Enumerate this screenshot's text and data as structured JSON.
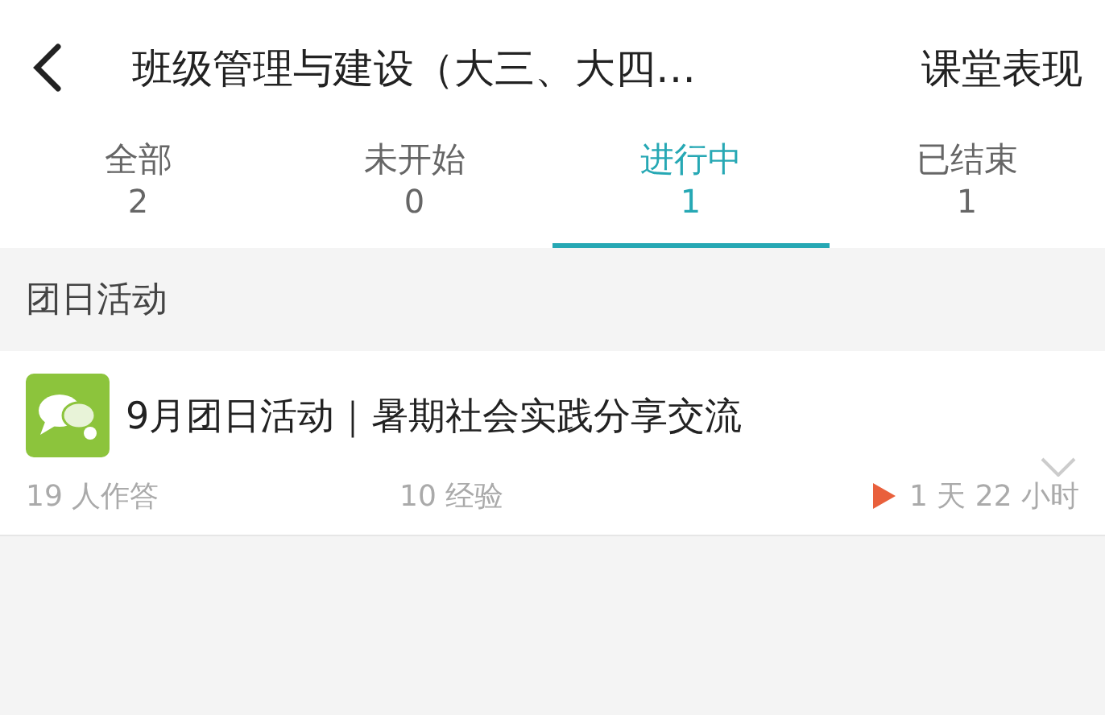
{
  "header": {
    "title": "班级管理与建设（大三、大四…",
    "action": "课堂表现"
  },
  "tabs": [
    {
      "label": "全部",
      "count": "2",
      "selected": false
    },
    {
      "label": "未开始",
      "count": "0",
      "selected": false
    },
    {
      "label": "进行中",
      "count": "1",
      "selected": true
    },
    {
      "label": "已结束",
      "count": "1",
      "selected": false
    }
  ],
  "section": {
    "title": "团日活动"
  },
  "activities": [
    {
      "title": "9月团日活动｜暑期社会实践分享交流",
      "responses": "19 人作答",
      "experience": "10 经验",
      "remaining": "1 天 22 小时"
    }
  ]
}
